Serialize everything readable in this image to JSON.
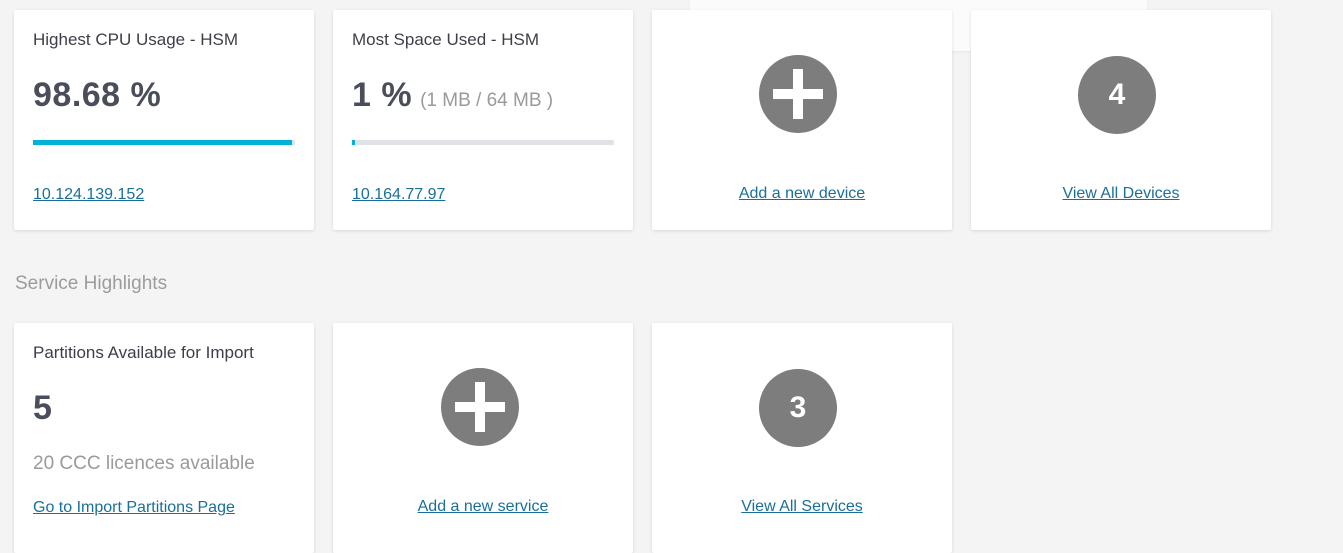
{
  "device_highlights": {
    "cpu_card": {
      "title": "Highest CPU Usage - HSM",
      "value": "98.68 %",
      "progress_fraction": 0.99,
      "link": "10.124.139.152"
    },
    "space_card": {
      "title": "Most Space Used - HSM",
      "value": "1 %",
      "detail": "(1 MB / 64 MB )",
      "progress_fraction": 0.01,
      "link": "10.164.77.97"
    },
    "add_device_card": {
      "icon": "plus-icon",
      "link": "Add a new device"
    },
    "devices_count_card": {
      "count": "4",
      "link": "View All Devices"
    }
  },
  "service_highlights": {
    "section_title": "Service Highlights",
    "partitions_card": {
      "title": "Partitions Available for Import",
      "value": "5",
      "detail": "20 CCC licences available",
      "link": "Go to Import Partitions Page"
    },
    "add_service_card": {
      "icon": "plus-icon",
      "link": "Add a new service"
    },
    "services_count_card": {
      "count": "3",
      "link": "View All Services"
    }
  },
  "colors": {
    "accent": "#00b2d5",
    "link": "#1a6f9a",
    "circle": "#7d7d7d",
    "background": "#f4f4f4"
  }
}
